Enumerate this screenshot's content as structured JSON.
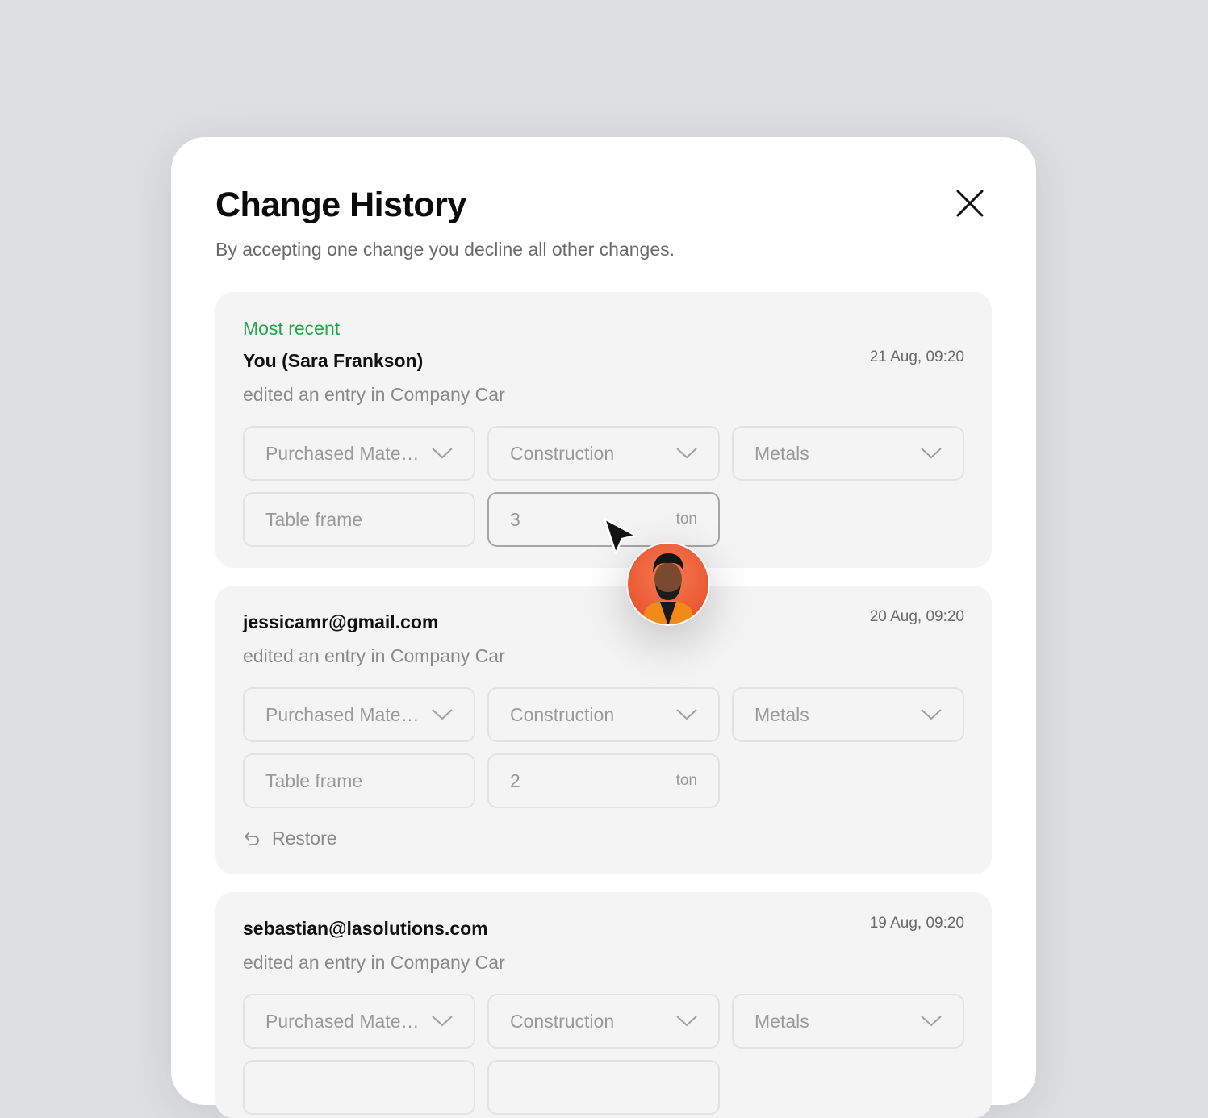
{
  "modal": {
    "title": "Change History",
    "subtitle": "By accepting one change you decline all other changes.",
    "close_icon": "close-icon"
  },
  "entries": [
    {
      "badge": "Most recent",
      "author": "You (Sara Frankson)",
      "time": "21 Aug, 09:20",
      "action": "edited an entry in Company Car",
      "category": "Purchased Mate…",
      "subcategory": "Construction",
      "material": "Metals",
      "item": "Table frame",
      "quantity": "3",
      "unit": "ton"
    },
    {
      "author": "jessicamr@gmail.com",
      "time": "20 Aug, 09:20",
      "action": "edited an entry in Company Car",
      "category": "Purchased Mate…",
      "subcategory": "Construction",
      "material": "Metals",
      "item": "Table frame",
      "quantity": "2",
      "unit": "ton",
      "restore_label": "Restore"
    },
    {
      "author": "sebastian@lasolutions.com",
      "time": "19 Aug, 09:20",
      "action": "edited an entry in Company Car",
      "category": "Purchased Mate…",
      "subcategory": "Construction",
      "material": "Metals"
    }
  ],
  "colors": {
    "accent_green": "#22a54c",
    "page_bg": "#dedfe1",
    "card_bg": "#f4f4f4"
  }
}
